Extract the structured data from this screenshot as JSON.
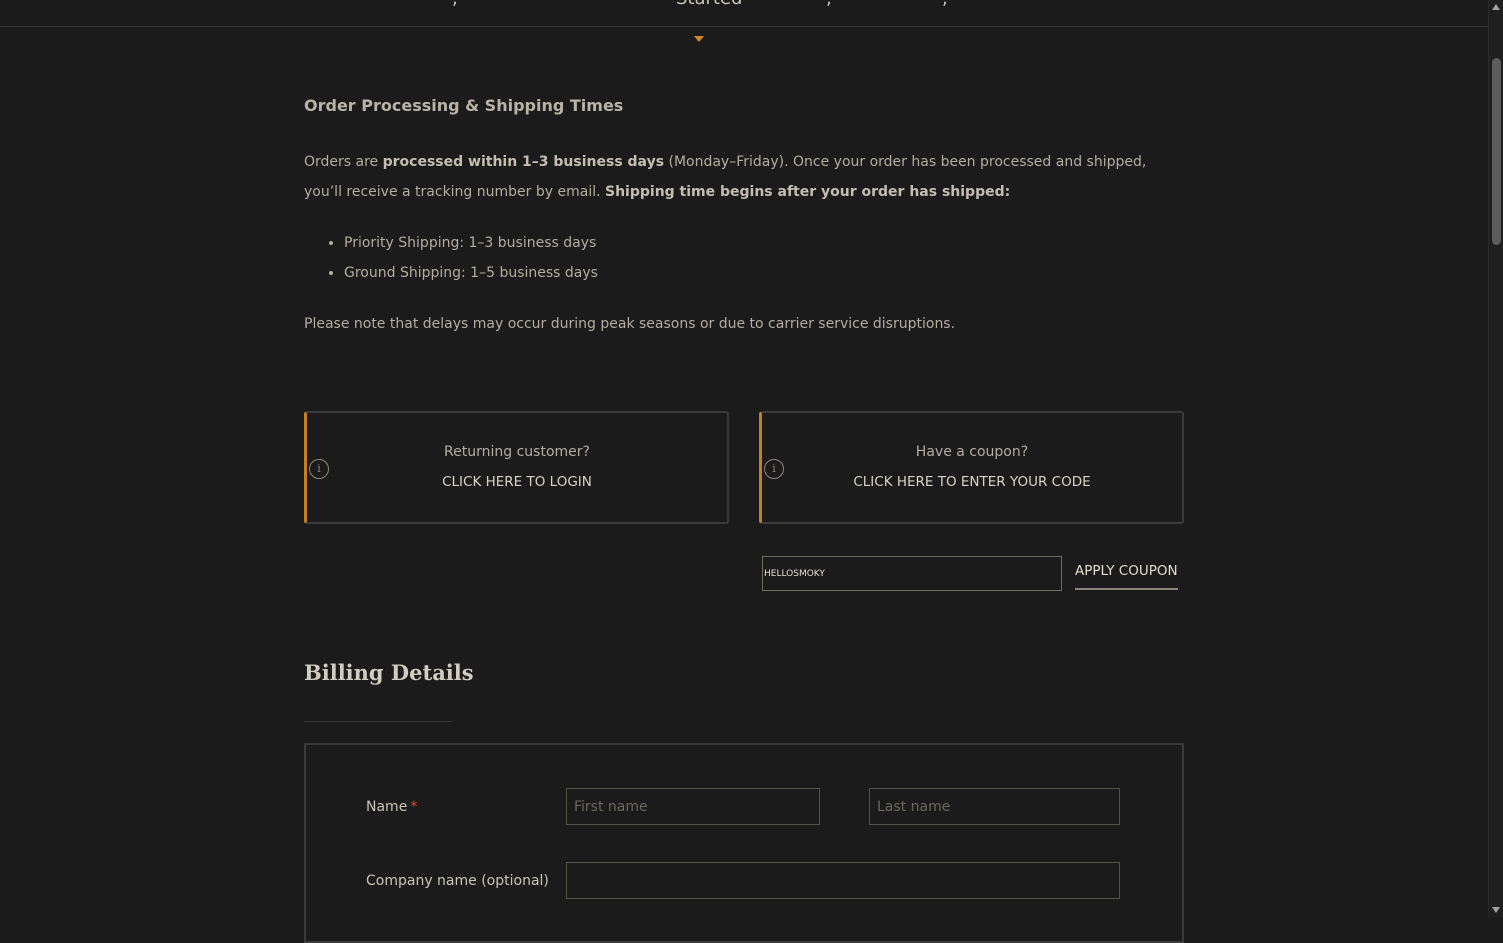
{
  "nav": {
    "active_item": "Started"
  },
  "shipping": {
    "title": "Order Processing & Shipping Times",
    "p1_a": "Orders are ",
    "p1_b": "processed within 1–3 business days",
    "p1_c": " (Monday–Friday). Once your order has been processed and shipped, you’ll receive a tracking number by email. ",
    "p1_d": "Shipping time begins after your order has shipped:",
    "list": [
      "Priority Shipping: 1–3 business days",
      "Ground Shipping: 1–5 business days"
    ],
    "note": "Please note that delays may occur during peak seasons or due to carrier service disruptions."
  },
  "notices": {
    "login_question": "Returning customer?",
    "login_cta": "CLICK HERE TO LOGIN",
    "coupon_question": "Have a coupon?",
    "coupon_cta": "CLICK HERE TO ENTER YOUR CODE",
    "icon": "info-icon",
    "info_glyph": "i"
  },
  "coupon": {
    "value": "HELLOSMOKY",
    "apply_label": "APPLY COUPON"
  },
  "billing": {
    "title": "Billing Details",
    "name_label": "Name",
    "required_mark": "*",
    "first_placeholder": "First name",
    "last_placeholder": "Last name",
    "company_label": "Company name (optional)",
    "company_value": ""
  },
  "colors": {
    "background": "#1b1b1b",
    "accent": "#c6801f",
    "required": "#d9463b"
  }
}
